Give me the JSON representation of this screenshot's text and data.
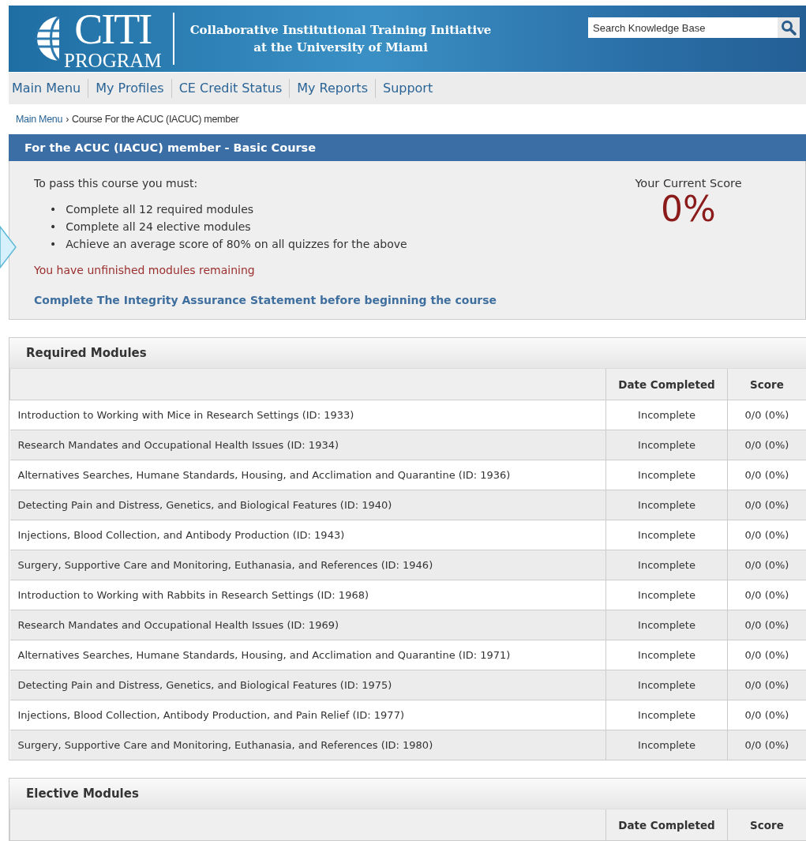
{
  "header": {
    "logo": {
      "title": "CITI",
      "subtitle": "PROGRAM"
    },
    "tagline": [
      "Collaborative Institutional Training Initiative",
      "at the University of Miami"
    ],
    "search": {
      "placeholder": "Search Knowledge Base"
    }
  },
  "nav": [
    "Main Menu",
    "My Profiles",
    "CE Credit Status",
    "My Reports",
    "Support"
  ],
  "breadcrumb": {
    "link": "Main Menu",
    "separator": "›",
    "current": "Course For the ACUC (IACUC) member"
  },
  "course": {
    "title": "For the ACUC (IACUC) member - Basic Course",
    "intro": "To pass this course you must:",
    "bullet": "•",
    "requirements": [
      "Complete all 12 required modules",
      "Complete all 24 elective modules",
      "Achieve an average score of 80% on all quizzes for the above"
    ],
    "warning": "You have unfinished modules remaining",
    "action": "Complete The Integrity Assurance Statement before beginning the course",
    "score_label": "Your Current Score",
    "score": "0%"
  },
  "sections": [
    {
      "title": "Required Modules",
      "columns": [
        "Date Completed",
        "Score"
      ],
      "rows": [
        {
          "module": "Introduction to Working with Mice in Research Settings (ID: 1933)",
          "date": "Incomplete",
          "score": "0/0 (0%)"
        },
        {
          "module": "Research Mandates and Occupational Health Issues (ID: 1934)",
          "date": "Incomplete",
          "score": "0/0 (0%)"
        },
        {
          "module": "Alternatives Searches, Humane Standards, Housing, and Acclimation and Quarantine (ID: 1936)",
          "date": "Incomplete",
          "score": "0/0 (0%)"
        },
        {
          "module": "Detecting Pain and Distress, Genetics, and Biological Features (ID: 1940)",
          "date": "Incomplete",
          "score": "0/0 (0%)"
        },
        {
          "module": "Injections, Blood Collection, and Antibody Production (ID: 1943)",
          "date": "Incomplete",
          "score": "0/0 (0%)"
        },
        {
          "module": "Surgery, Supportive Care and Monitoring, Euthanasia, and References (ID: 1946)",
          "date": "Incomplete",
          "score": "0/0 (0%)"
        },
        {
          "module": "Introduction to Working with Rabbits in Research Settings (ID: 1968)",
          "date": "Incomplete",
          "score": "0/0 (0%)"
        },
        {
          "module": "Research Mandates and Occupational Health Issues (ID: 1969)",
          "date": "Incomplete",
          "score": "0/0 (0%)"
        },
        {
          "module": "Alternatives Searches, Humane Standards, Housing, and Acclimation and Quarantine (ID: 1971)",
          "date": "Incomplete",
          "score": "0/0 (0%)"
        },
        {
          "module": "Detecting Pain and Distress, Genetics, and Biological Features (ID: 1975)",
          "date": "Incomplete",
          "score": "0/0 (0%)"
        },
        {
          "module": "Injections, Blood Collection, Antibody Production, and Pain Relief (ID: 1977)",
          "date": "Incomplete",
          "score": "0/0 (0%)"
        },
        {
          "module": "Surgery, Supportive Care and Monitoring, Euthanasia, and References (ID: 1980)",
          "date": "Incomplete",
          "score": "0/0 (0%)"
        }
      ]
    },
    {
      "title": "Elective Modules",
      "columns": [
        "Date Completed",
        "Score"
      ]
    }
  ]
}
